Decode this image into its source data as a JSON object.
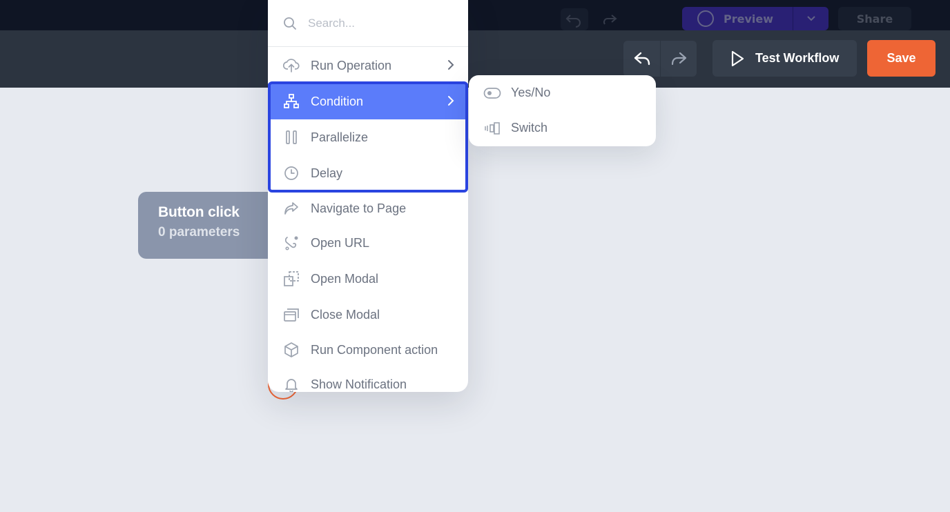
{
  "topbar": {
    "preview_label": "Preview",
    "share_label": "Share"
  },
  "header": {
    "test_workflow_label": "Test Workflow",
    "save_label": "Save"
  },
  "canvas": {
    "node_title": "Button click",
    "node_subtitle": "0 parameters"
  },
  "menu": {
    "search_placeholder": "Search...",
    "items": [
      {
        "label": "Run Operation",
        "icon": "cloud-upload-icon"
      },
      {
        "label": "Condition",
        "icon": "sitemap-icon",
        "active": true
      },
      {
        "label": "Parallelize",
        "icon": "parallel-bars-icon"
      },
      {
        "label": "Delay",
        "icon": "clock-icon"
      },
      {
        "label": "Navigate to Page",
        "icon": "share-arrow-icon"
      },
      {
        "label": "Open URL",
        "icon": "link-path-icon"
      },
      {
        "label": "Open Modal",
        "icon": "open-modal-icon"
      },
      {
        "label": "Close Modal",
        "icon": "close-modal-icon"
      },
      {
        "label": "Run Component action",
        "icon": "cube-icon"
      },
      {
        "label": "Show Notification",
        "icon": "bell-icon"
      }
    ]
  },
  "submenu": {
    "items": [
      {
        "label": "Yes/No",
        "icon": "toggle-icon"
      },
      {
        "label": "Switch",
        "icon": "switch-icon"
      }
    ]
  },
  "colors": {
    "accent": "#5b7cfa",
    "save": "#ee6535",
    "header_bg": "#2c3440",
    "canvas_bg": "#e7eaf0"
  }
}
